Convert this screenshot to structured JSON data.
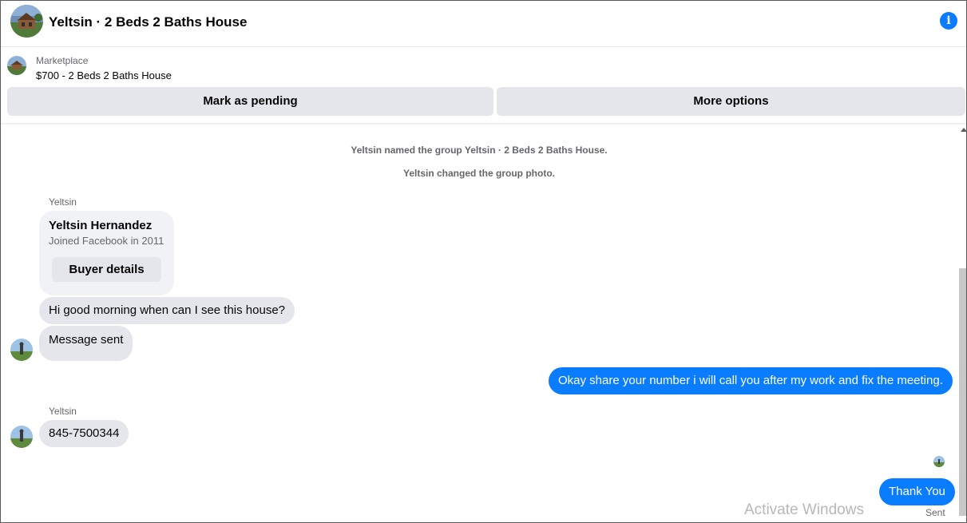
{
  "header": {
    "title": "Yeltsin · 2 Beds 2 Baths House",
    "info_icon": "info-icon",
    "info_glyph": "i",
    "accent": "#0a7cff"
  },
  "marketplace": {
    "label": "Marketplace",
    "item": "$700 - 2 Beds 2 Baths House",
    "mark_pending_label": "Mark as pending",
    "more_options_label": "More options"
  },
  "chat": {
    "system_messages": [
      "Yeltsin named the group Yeltsin · 2 Beds 2 Baths House.",
      "Yeltsin changed the group photo."
    ],
    "buyer_card": {
      "sender": "Yeltsin",
      "name": "Yeltsin Hernandez",
      "joined": "Joined Facebook in 2011",
      "button_label": "Buyer details"
    },
    "messages": [
      {
        "from": "them",
        "text": "Hi good morning when can I see this house?"
      },
      {
        "from": "them",
        "text": "Message sent"
      },
      {
        "from": "me",
        "text": "Okay share your number i will call you after my work and fix the meeting."
      },
      {
        "from": "them",
        "sender": "Yeltsin",
        "text": "845-7500344"
      },
      {
        "from": "me",
        "text": "Thank You"
      }
    ],
    "status": "Sent"
  },
  "os_watermark": "Activate Windows"
}
